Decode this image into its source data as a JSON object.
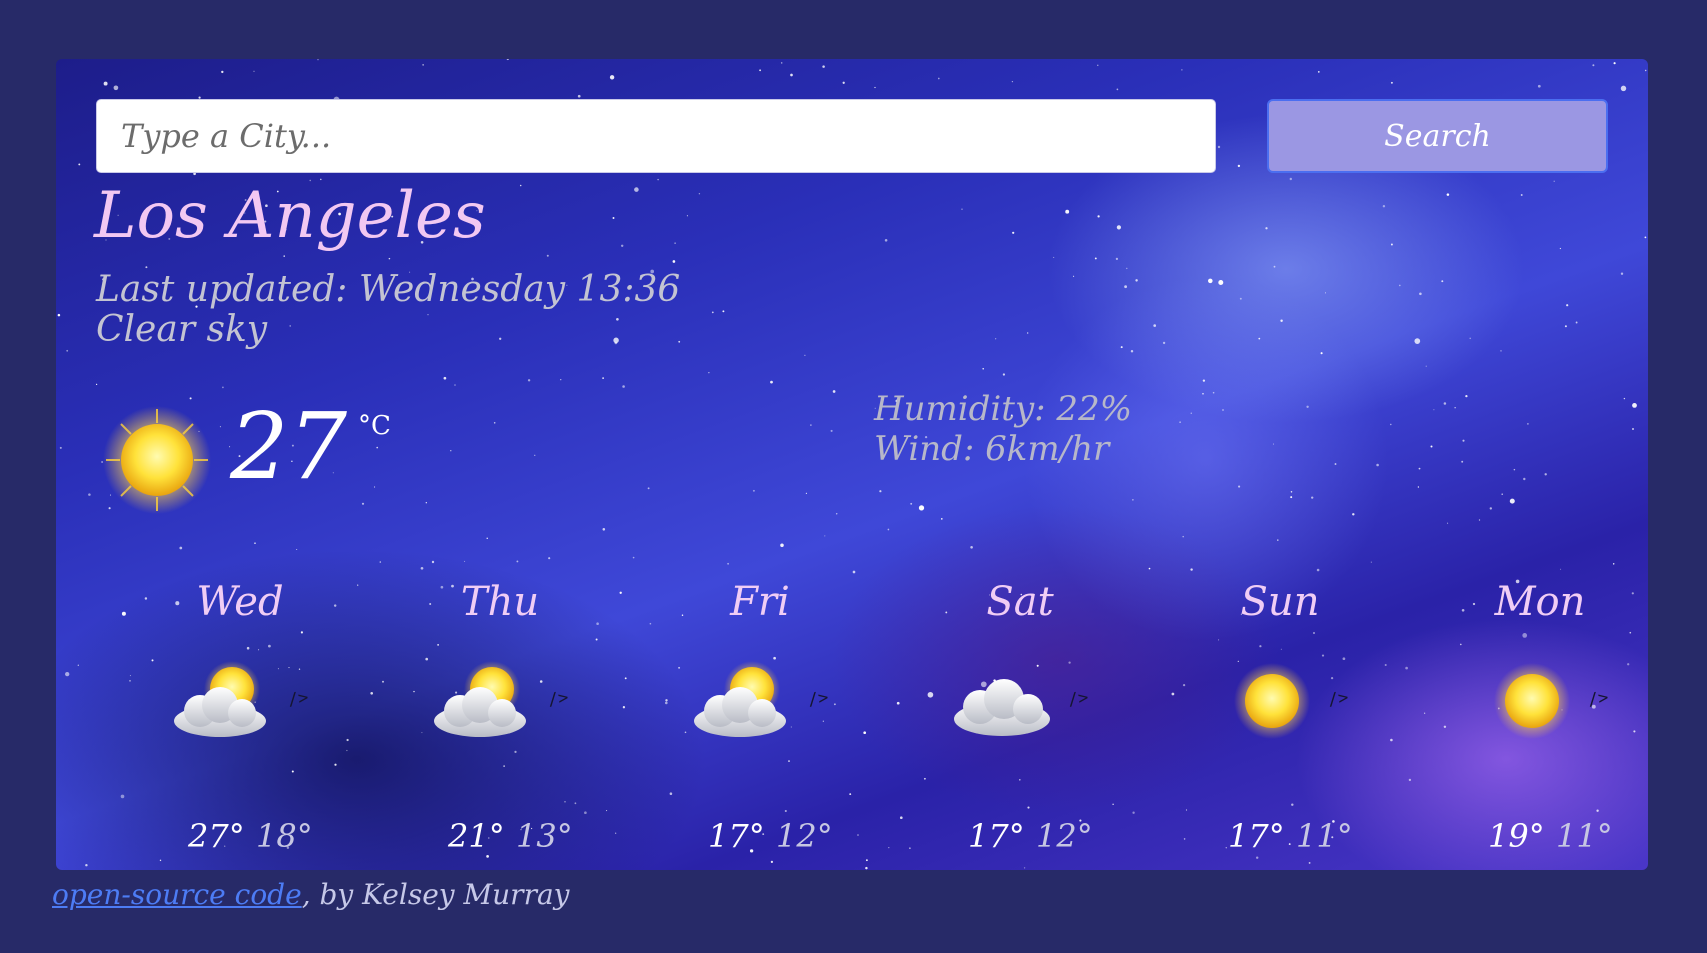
{
  "search": {
    "placeholder": "Type a City...",
    "button_label": "Search"
  },
  "current": {
    "city": "Los Angeles",
    "last_updated": "Last updated: Wednesday 13:36",
    "description": "Clear sky",
    "temperature": "27",
    "unit": "°C",
    "icon": "sun-icon",
    "humidity": "Humidity: 22%",
    "wind": "Wind: 6km/hr"
  },
  "forecast": [
    {
      "day": "Wed",
      "icon": "partly-cloudy-icon",
      "mark": "/>",
      "max": "27°",
      "min": "18°"
    },
    {
      "day": "Thu",
      "icon": "partly-cloudy-icon",
      "mark": "/>",
      "max": "21°",
      "min": "13°"
    },
    {
      "day": "Fri",
      "icon": "partly-cloudy-icon",
      "mark": "/>",
      "max": "17°",
      "min": "12°"
    },
    {
      "day": "Sat",
      "icon": "cloud-icon",
      "mark": "/>",
      "max": "17°",
      "min": "12°"
    },
    {
      "day": "Sun",
      "icon": "sun-icon",
      "mark": "/>",
      "max": "17°",
      "min": "11°"
    },
    {
      "day": "Mon",
      "icon": "sun-icon",
      "mark": "/>",
      "max": "19°",
      "min": "11°"
    }
  ],
  "footer": {
    "link_text": "open-source code",
    "suffix": ", by Kelsey Murray"
  },
  "colors": {
    "page_background": "#272a68",
    "button": "#9b97e3",
    "city": "#f2c8f2",
    "link": "#4d7cf5"
  }
}
